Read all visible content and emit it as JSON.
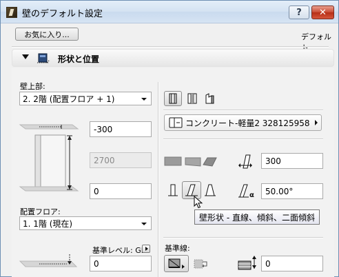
{
  "window": {
    "title": "壁のデフォルト設定",
    "help_label": "?",
    "close_label": "✕"
  },
  "toolbar": {
    "favorites_label": "お気に入り...",
    "default_label": "デフォルト"
  },
  "section": {
    "title": "形状と位置"
  },
  "left": {
    "top_label": "壁上部:",
    "top_value": "2. 2階 (配置フロア + 1)",
    "offset_top": "-300",
    "height": "2700",
    "offset_bottom": "0",
    "floor_label": "配置フロア:",
    "floor_value": "1. 1階 (現在)",
    "ref_level_label": "基準レベル: GL",
    "ref_level_value": "0"
  },
  "right": {
    "material_label": "コンクリート-軽量2 328125958",
    "thickness": "300",
    "angle": "50.00°",
    "tooltip": "壁形状 - 直線、傾斜、二面傾斜",
    "refline_label": "基準線:",
    "refline_offset": "0"
  },
  "icons": {
    "accent_selected": "#d8d8d8",
    "gray_shape": "#8e8e8e"
  }
}
